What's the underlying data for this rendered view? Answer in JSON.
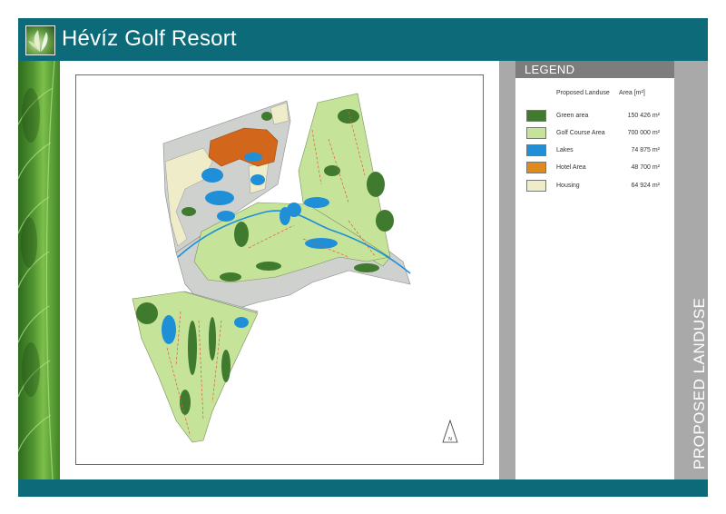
{
  "header": {
    "title": "Hévíz Golf Resort"
  },
  "legend": {
    "title": "LEGEND",
    "col_landuse": "Proposed Landuse",
    "col_area": "Area [m²]",
    "items": [
      {
        "label": "Green area",
        "area": "150 426 m²",
        "color": "#3f7a2e"
      },
      {
        "label": "Golf Course Area",
        "area": "700 000 m²",
        "color": "#c6e39a"
      },
      {
        "label": "Lakes",
        "area": "74 875 m²",
        "color": "#1f8fd8"
      },
      {
        "label": "Hotel Area",
        "area": "48 700 m²",
        "color": "#e08a1c"
      },
      {
        "label": "Housing",
        "area": "64 924 m²",
        "color": "#efedc9"
      }
    ]
  },
  "side_title": "PROPOSED LANDUSE",
  "map": {
    "north_label": "N"
  }
}
